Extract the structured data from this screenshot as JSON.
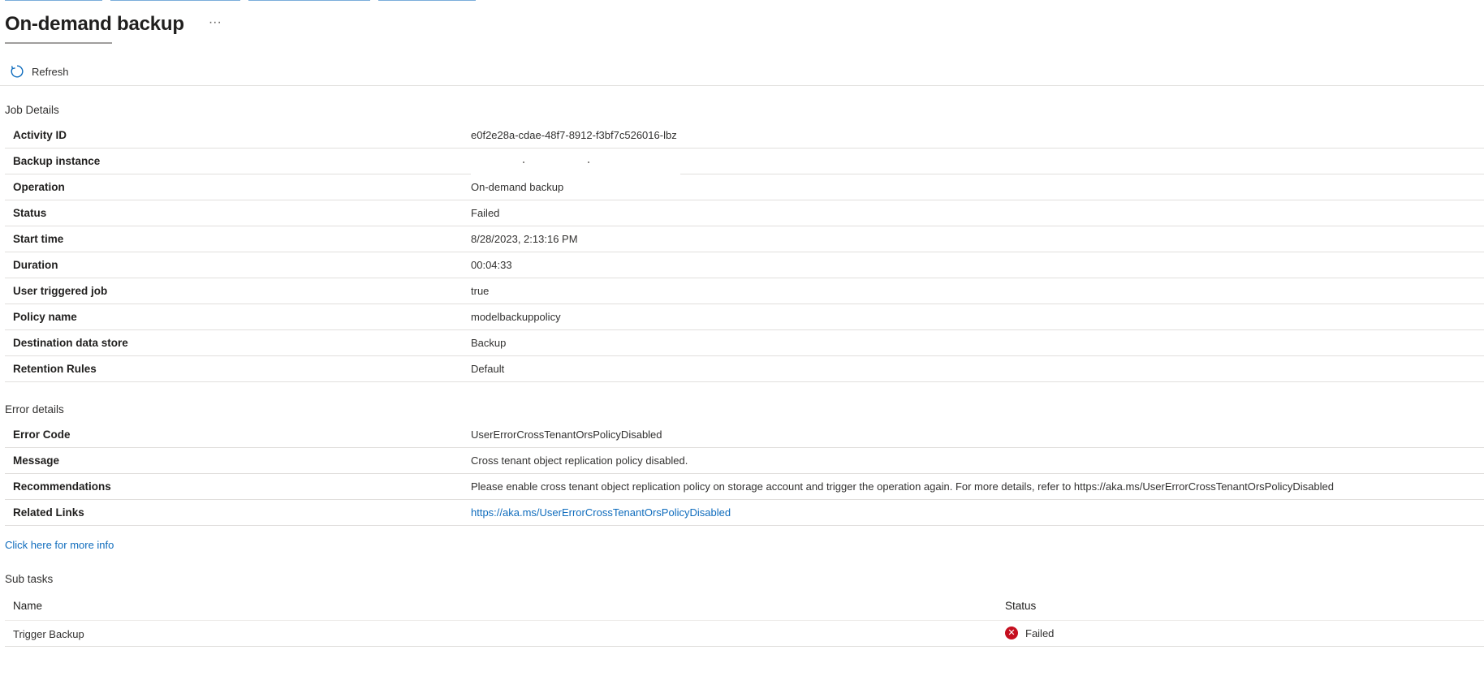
{
  "header": {
    "title": "On-demand backup",
    "more_label": "···"
  },
  "toolbar": {
    "refresh_label": "Refresh"
  },
  "job_details": {
    "section_label": "Job Details",
    "rows": [
      {
        "key": "Activity ID",
        "value": "e0f2e28a-cdae-48f7-8912-f3bf7c526016-lbz"
      },
      {
        "key": "Backup instance",
        "value": ""
      },
      {
        "key": "Operation",
        "value": "On-demand backup"
      },
      {
        "key": "Status",
        "value": "Failed"
      },
      {
        "key": "Start time",
        "value": "8/28/2023, 2:13:16 PM"
      },
      {
        "key": "Duration",
        "value": "00:04:33"
      },
      {
        "key": "User triggered job",
        "value": "true"
      },
      {
        "key": "Policy name",
        "value": "modelbackuppolicy"
      },
      {
        "key": "Destination data store",
        "value": "Backup"
      },
      {
        "key": "Retention Rules",
        "value": "Default"
      }
    ]
  },
  "error_details": {
    "section_label": "Error details",
    "rows": [
      {
        "key": "Error Code",
        "value": "UserErrorCrossTenantOrsPolicyDisabled"
      },
      {
        "key": "Message",
        "value": "Cross tenant object replication policy disabled."
      },
      {
        "key": "Recommendations",
        "value": "Please enable cross tenant object replication policy on storage account and trigger the operation again. For more details, refer to https://aka.ms/UserErrorCrossTenantOrsPolicyDisabled"
      },
      {
        "key": "Related Links",
        "value": "https://aka.ms/UserErrorCrossTenantOrsPolicyDisabled"
      }
    ],
    "more_info_link": "Click here for more info"
  },
  "sub_tasks": {
    "section_label": "Sub tasks",
    "columns": {
      "name": "Name",
      "status": "Status"
    },
    "rows": [
      {
        "name": "Trigger Backup",
        "status": "Failed",
        "status_icon": "error-icon"
      }
    ]
  },
  "colors": {
    "link": "#0f6cbd",
    "error": "#c50f1f",
    "divider": "#e1dfdd"
  }
}
